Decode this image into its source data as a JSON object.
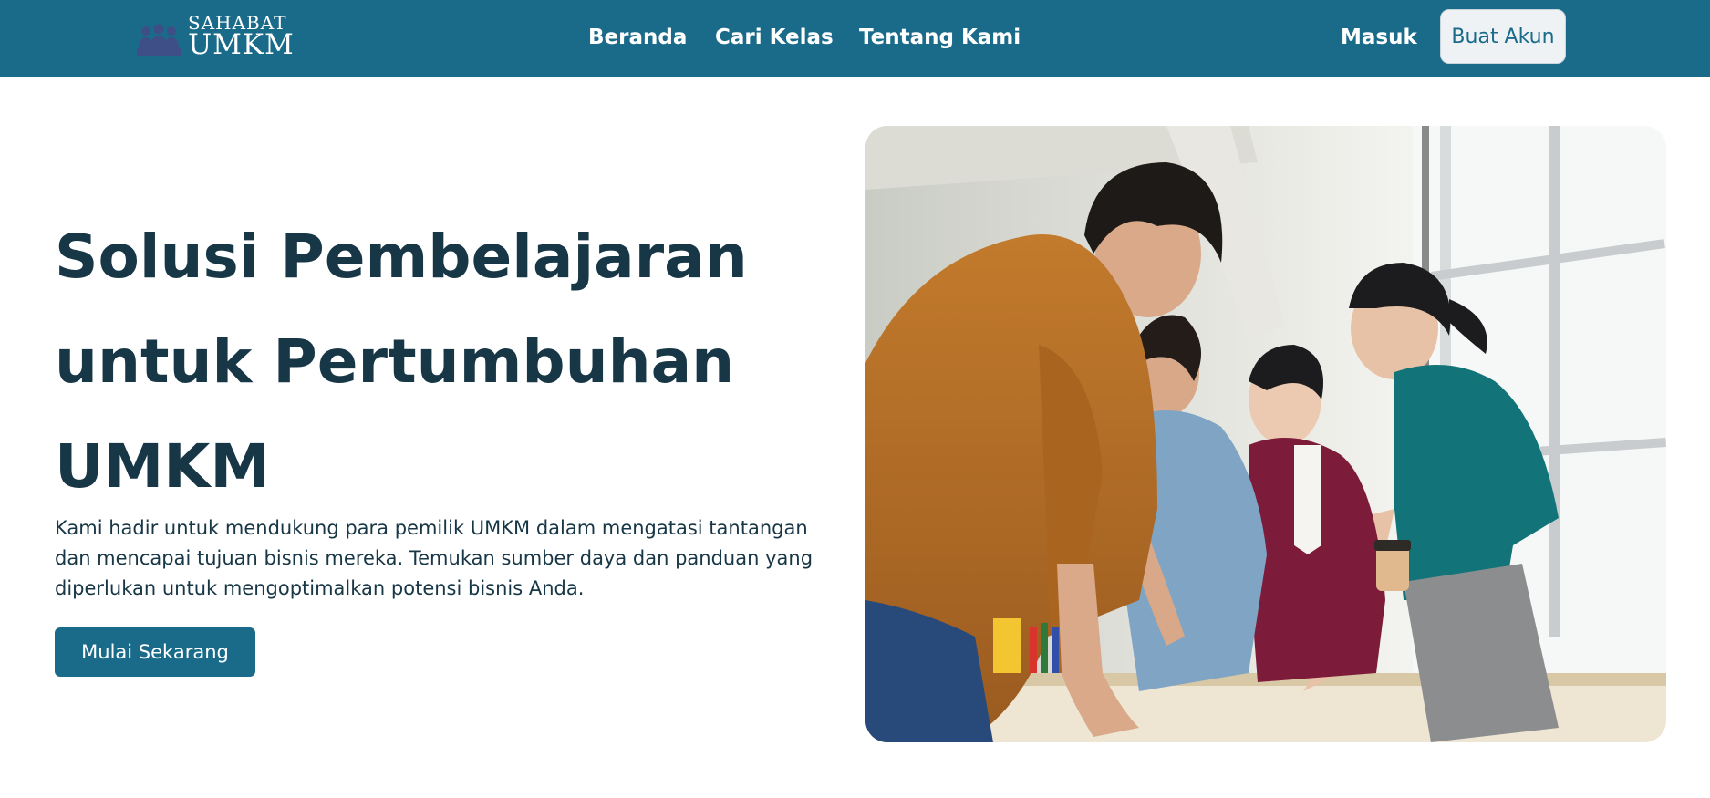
{
  "navbar": {
    "logo": {
      "top_text": "SAHABAT",
      "bottom_text": "UMKM"
    },
    "links": [
      "Beranda",
      "Cari Kelas",
      "Tentang Kami"
    ],
    "login_label": "Masuk",
    "signup_label": "Buat Akun"
  },
  "hero": {
    "title": "Solusi Pembelajaran untuk Pertumbuhan UMKM",
    "description": "Kami hadir untuk mendukung para pemilik UMKM dalam mengatasi tantangan dan mencapai tujuan bisnis mereka. Temukan sumber daya dan panduan yang diperlukan untuk mengoptimalkan potensi bisnis Anda.",
    "cta_label": "Mulai Sekarang"
  },
  "colors": {
    "primary": "#1a6b8a",
    "heading": "#173646",
    "button_light_bg": "#eef2f4"
  }
}
